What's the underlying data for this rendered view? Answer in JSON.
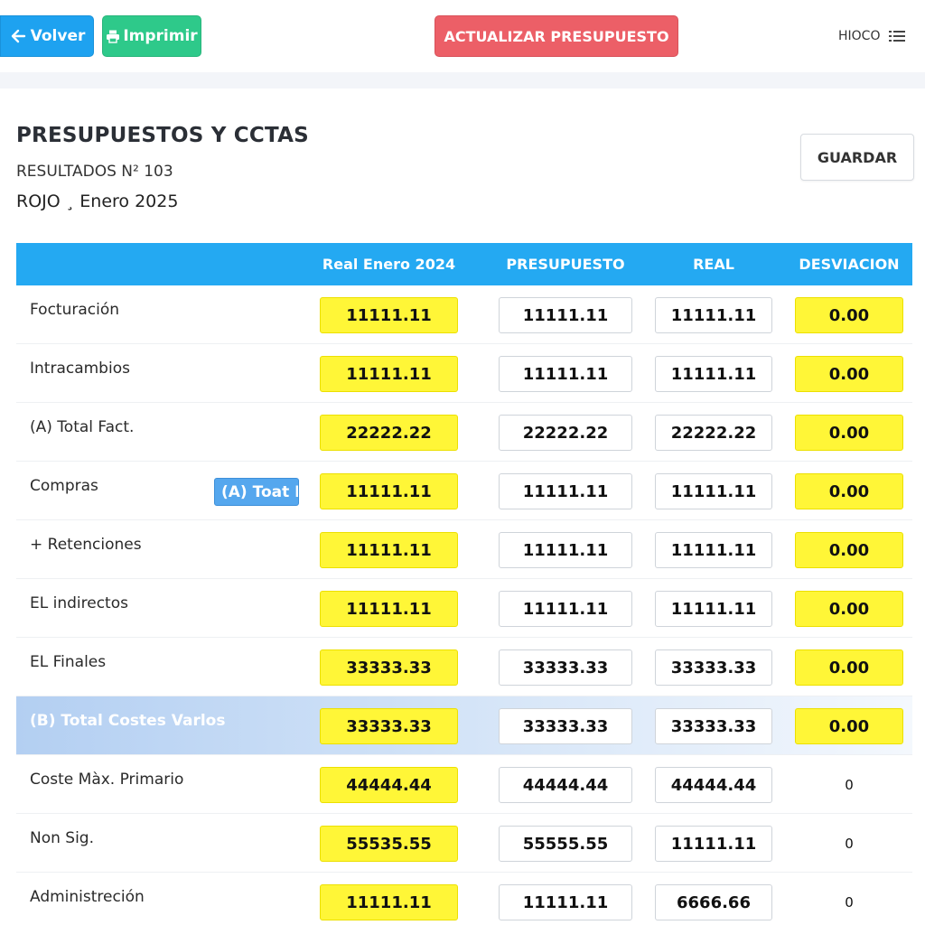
{
  "toolbar": {
    "back_label": "Volver",
    "print_label": "Imprimir",
    "update_label": "ACTUALIZAR PRESUPUESTO",
    "user_label": "HIOCO"
  },
  "header": {
    "title": "PRESUPUESTOS Y CCTAS",
    "subtitle": "RESULTADOS N² 103",
    "period": "ROJO ¸ Enero 2025",
    "save_label": "GUARDAR"
  },
  "table": {
    "columns": [
      "",
      "Real Enero 2024",
      "PRESUPUESTO",
      "REAL",
      "DESVIACION"
    ],
    "rows": [
      {
        "label": "Focturación",
        "real_prev": "11111.11",
        "budget": "11111.11",
        "real": "11111.11",
        "deviation": "0.00"
      },
      {
        "label": "Intracambios",
        "real_prev": "11111.11",
        "budget": "11111.11",
        "real": "11111.11",
        "deviation": "0.00"
      },
      {
        "label": "(A) Total Fact.",
        "real_prev": "22222.22",
        "budget": "22222.22",
        "real": "22222.22",
        "deviation": "0.00"
      },
      {
        "label": "Compras",
        "tag": "(A) Toat Fact.",
        "real_prev": "11111.11",
        "budget": "11111.11",
        "real": "11111.11",
        "deviation": "0.00"
      },
      {
        "label": "+ Retenciones",
        "real_prev": "11111.11",
        "budget": "11111.11",
        "real": "11111.11",
        "deviation": "0.00"
      },
      {
        "label": "EL indirectos",
        "real_prev": "11111.11",
        "budget": "11111.11",
        "real": "11111.11",
        "deviation": "0.00"
      },
      {
        "label": "EL Finales",
        "real_prev": "33333.33",
        "budget": "33333.33",
        "real": "33333.33",
        "deviation": "0.00"
      },
      {
        "label": "(B) Total Costes Varlos",
        "real_prev": "33333.33",
        "budget": "33333.33",
        "real": "33333.33",
        "deviation": "0.00"
      },
      {
        "label": "Coste Màx. Primario",
        "real_prev": "44444.44",
        "budget": "44444.44",
        "real": "44444.44",
        "deviation": "0"
      },
      {
        "label": "Non Sig.",
        "real_prev": "55535.55",
        "budget": "55555.55",
        "real": "11111.11",
        "deviation": "0"
      },
      {
        "label": "Administreción",
        "real_prev": "11111.11",
        "budget": "11111.11",
        "real": "6666.66",
        "deviation": "0"
      }
    ]
  },
  "icons": {
    "back": "arrow-left-icon",
    "print": "printer-icon",
    "menu": "list-menu-icon"
  },
  "colors": {
    "back_button": "#1ea2f0",
    "print_button": "#2ec98a",
    "update_button": "#ec5f67",
    "table_header": "#24a9f2",
    "highlight_cell": "#fff637"
  }
}
